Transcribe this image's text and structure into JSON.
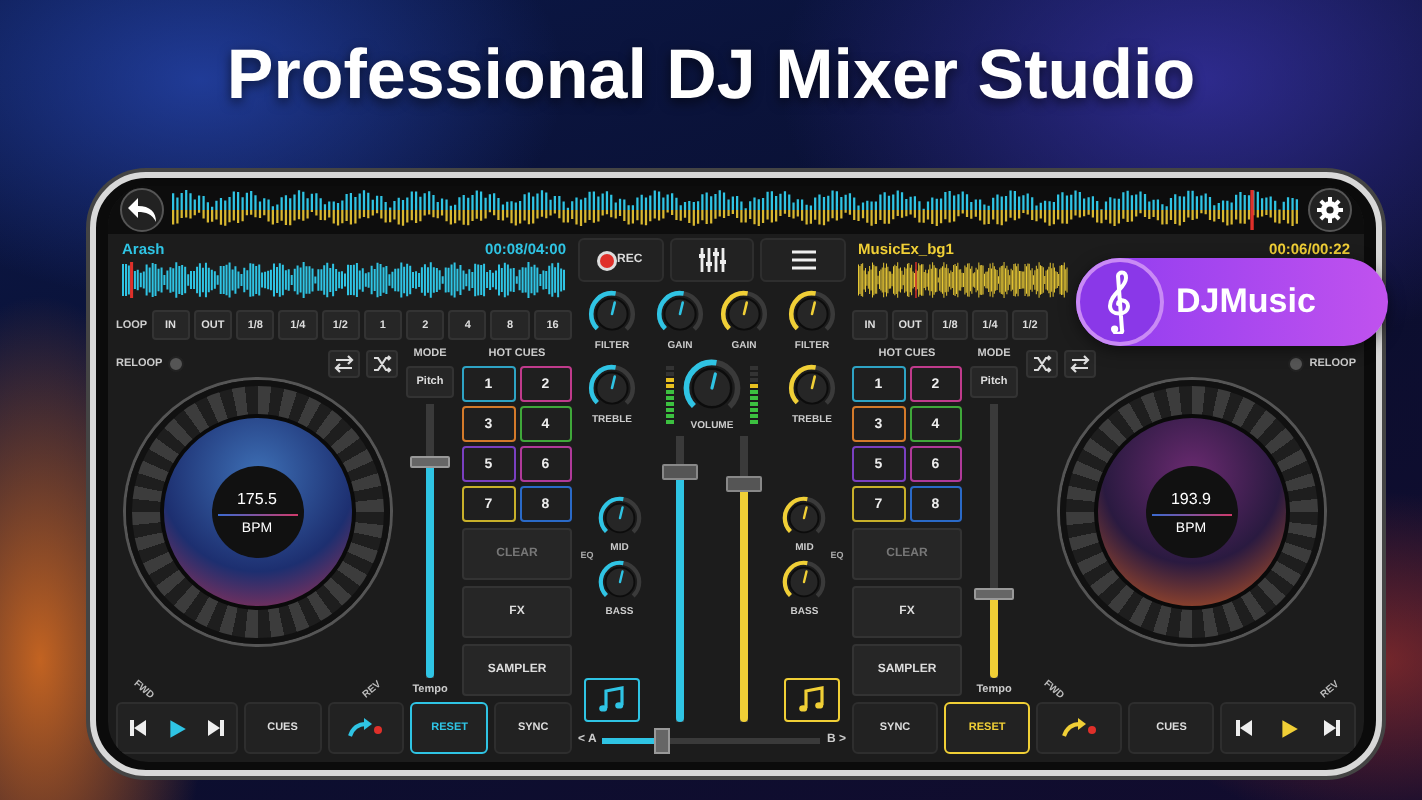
{
  "headline": "Professional DJ Mixer Studio",
  "badge": {
    "label": "DJMusic"
  },
  "decks": [
    {
      "kind": "left",
      "color": "#2fc4e4",
      "title": "Arash",
      "time": "00:08/04:00",
      "loop_label": "LOOP",
      "loop_buttons": [
        "IN",
        "OUT",
        "1/8",
        "1/4",
        "1/2",
        "1",
        "2",
        "4",
        "8",
        "16"
      ],
      "reloop": "RELOOP",
      "mode": "MODE",
      "hot_cues_label": "HOT CUES",
      "pitch": "Pitch",
      "pitch_slider": {
        "level": 0.8
      },
      "tempo": "Tempo",
      "hot_cues": [
        {
          "label": "1",
          "color": "#2ea3c4"
        },
        {
          "label": "2",
          "color": "#c03b8c"
        },
        {
          "label": "3",
          "color": "#d47a2a"
        },
        {
          "label": "4",
          "color": "#3fa83a"
        },
        {
          "label": "5",
          "color": "#7a3fc0"
        },
        {
          "label": "6",
          "color": "#b03a9a"
        },
        {
          "label": "7",
          "color": "#c8b02a"
        },
        {
          "label": "8",
          "color": "#2a6ac8"
        }
      ],
      "pad_buttons": [
        {
          "label": "CLEAR",
          "disabled": true
        },
        {
          "label": "FX",
          "disabled": false
        },
        {
          "label": "SAMPLER",
          "disabled": false
        }
      ],
      "bpm": "175.5",
      "bpm_label": "BPM",
      "fwd": "FWD",
      "rev": "REV",
      "cues": "CUES",
      "reset": "RESET",
      "sync": "SYNC"
    },
    {
      "kind": "right",
      "color": "#f0cf36",
      "title": "MusicEx_bg1",
      "time": "00:06/00:22",
      "loop_buttons": [
        "IN",
        "OUT",
        "1/8",
        "1/4",
        "1/2"
      ],
      "reloop": "RELOOP",
      "mode": "MODE",
      "hot_cues_label": "HOT CUES",
      "pitch": "Pitch",
      "pitch_slider": {
        "level": 0.3
      },
      "tempo": "Tempo",
      "hot_cues": [
        {
          "label": "1",
          "color": "#2ea3c4"
        },
        {
          "label": "2",
          "color": "#c03b8c"
        },
        {
          "label": "3",
          "color": "#d47a2a"
        },
        {
          "label": "4",
          "color": "#3fa83a"
        },
        {
          "label": "5",
          "color": "#7a3fc0"
        },
        {
          "label": "6",
          "color": "#b03a9a"
        },
        {
          "label": "7",
          "color": "#c8b02a"
        },
        {
          "label": "8",
          "color": "#2a6ac8"
        }
      ],
      "pad_buttons": [
        {
          "label": "CLEAR",
          "disabled": true
        },
        {
          "label": "FX",
          "disabled": false
        },
        {
          "label": "SAMPLER",
          "disabled": false
        }
      ],
      "bpm": "193.9",
      "bpm_label": "BPM",
      "fwd": "FWD",
      "rev": "REV",
      "cues": "CUES",
      "reset": "RESET",
      "sync": "SYNC"
    }
  ],
  "mixer": {
    "rec": "REC",
    "channels": [
      {
        "color": "#2fc4e4",
        "filter": {
          "label": "FILTER"
        },
        "gain": {
          "label": "GAIN"
        },
        "treble": {
          "label": "TREBLE"
        },
        "eq": "EQ",
        "mid": {
          "label": "MID"
        },
        "bass": {
          "label": "BASS"
        },
        "fader": {
          "level": 0.9
        },
        "vu": {
          "level": 0.75
        }
      },
      {
        "color": "#f0cf36",
        "filter": {
          "label": "FILTER"
        },
        "gain": {
          "label": "GAIN"
        },
        "treble": {
          "label": "TREBLE"
        },
        "eq": "EQ",
        "mid": {
          "label": "MID"
        },
        "bass": {
          "label": "BASS"
        },
        "fader": {
          "level": 0.85
        },
        "vu": {
          "level": 0.7
        }
      }
    ],
    "volume": {
      "label": "VOLUME"
    },
    "crossfader": {
      "a": "< A",
      "b": "B >",
      "level": 0.25
    }
  }
}
